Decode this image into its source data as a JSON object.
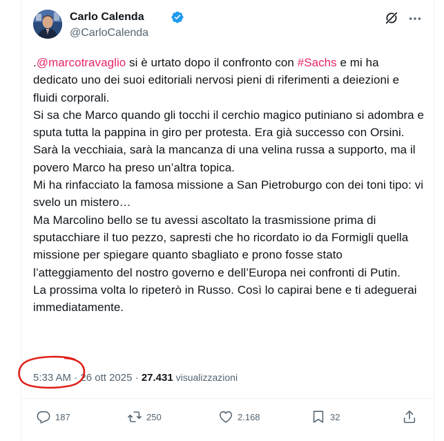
{
  "author": {
    "name": "Carlo Calenda",
    "handle": "@CarloCalenda"
  },
  "tweet": {
    "prefix": ".",
    "mention": "@marcotravaglio",
    "seg1": " si è urtato dopo il confronto con ",
    "hashtag": "#Sachs",
    "seg2": " e mi ha dedicato uno dei suoi editoriali nervosi pieni di riferimenti a deiezioni e fluidi corporali.\nSi sa che Marco quando gli tocchi il cerchio magico putiniano si adombra e sputa tutta la pappina in giro per protesta. Era già successo con Orsini.\nSarà la vecchiaia, sarà la mancanza di una velina russa a supporto, ma il povero Marco ha preso un’altra topica.\nMi ha rinfacciato la famosa missione a San Pietroburgo con dei toni tipo: vi svelo un mistero…\nMa Marcolino bello se tu avessi ascoltato la trasmissione prima di sputacchiare il tuo pezzo, sapresti che ho ricordato io da Formigli quella missione per spiegare quanto sbagliato e prono fosse stato l’atteggiamento del nostro governo e dell’Europa nei confronti di Putin.\nLa prossima volta lo ripeterò in Russo. Così lo capirai bene e ti adeguerai immediatamente."
  },
  "meta": {
    "time": "5:33 AM",
    "sep1": " · ",
    "date": "26 ott 2025",
    "sep2": " · ",
    "views_count": "27.431",
    "views_label": " visualizzazioni"
  },
  "actions": {
    "replies": "187",
    "reposts": "250",
    "likes": "2.168",
    "bookmarks": "32"
  },
  "colors": {
    "accent": "#e8246b",
    "verified": "#1d9bf0",
    "secondary_text": "#536471",
    "annotation": "#e0201b"
  },
  "icons": [
    "verified-badge-icon",
    "grok-icon",
    "more-icon",
    "reply-icon",
    "repost-icon",
    "like-icon",
    "bookmark-icon",
    "share-icon"
  ]
}
